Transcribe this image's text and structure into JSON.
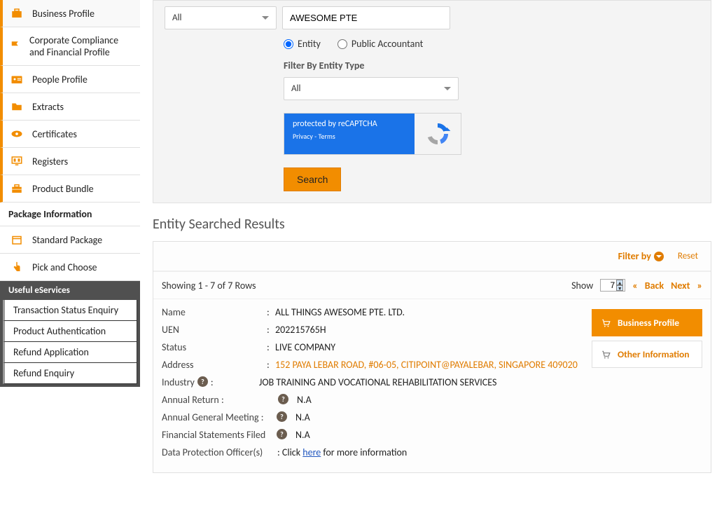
{
  "sidebar": {
    "items": [
      {
        "label": "Business Profile"
      },
      {
        "label": "Corporate Compliance and Financial Profile"
      },
      {
        "label": "People Profile"
      },
      {
        "label": "Extracts"
      },
      {
        "label": "Certificates"
      },
      {
        "label": "Registers"
      },
      {
        "label": "Product Bundle"
      }
    ],
    "package_header": "Package Information",
    "package_items": [
      {
        "label": "Standard Package"
      },
      {
        "label": "Pick and Choose"
      }
    ],
    "eservices_header": "Useful eServices",
    "eservices_items": [
      {
        "label": "Transaction Status Enquiry"
      },
      {
        "label": "Product Authentication"
      },
      {
        "label": "Refund Application"
      },
      {
        "label": "Refund Enquiry"
      }
    ]
  },
  "search": {
    "dropdown_value": "All",
    "input_value": "AWESOME PTE",
    "radio_entity": "Entity",
    "radio_public": "Public Accountant",
    "filter_label": "Filter By Entity Type",
    "filter_value": "All",
    "captcha_text": "protected by reCAPTCHA",
    "captcha_privacy": "Privacy",
    "captcha_terms": "Terms",
    "search_btn": "Search"
  },
  "results": {
    "title": "Entity Searched Results",
    "filter_by": "Filter by",
    "reset": "Reset",
    "showing": "Showing 1 - 7 of 7 Rows",
    "show_label": "Show",
    "show_value": "7",
    "back": "Back",
    "next": "Next",
    "fields": {
      "name_label": "Name",
      "name_value": "ALL THINGS AWESOME PTE. LTD.",
      "uen_label": "UEN",
      "uen_value": "202215765H",
      "status_label": "Status",
      "status_value": "LIVE COMPANY",
      "address_label": "Address",
      "address_value": "152 PAYA LEBAR ROAD, #06-05, CITIPOINT@PAYALEBAR, SINGAPORE 409020",
      "industry_label": "Industry",
      "industry_value": "JOB TRAINING AND VOCATIONAL REHABILITATION SERVICES",
      "ar_label": "Annual Return :",
      "ar_value": "N.A",
      "agm_label": "Annual General Meeting :",
      "agm_value": "N.A",
      "fsf_label": "Financial Statements Filed",
      "fsf_value": "N.A",
      "dpo_label": "Data Protection Officer(s)",
      "dpo_prefix": ": Click ",
      "dpo_link": "here",
      "dpo_suffix": " for more information"
    },
    "actions": {
      "business_profile": "Business Profile",
      "other_info": "Other Information"
    }
  }
}
